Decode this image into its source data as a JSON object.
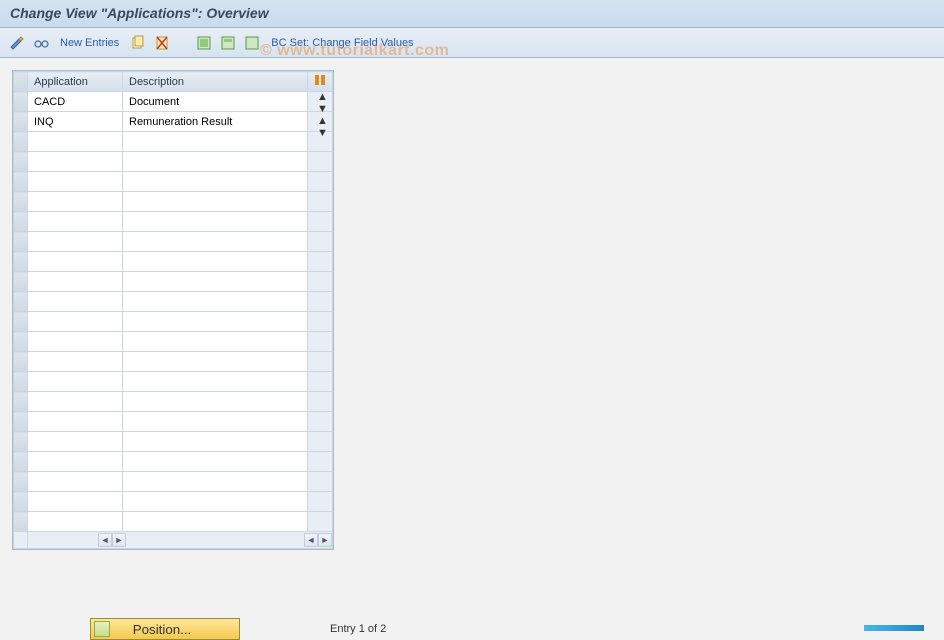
{
  "title": "Change View \"Applications\": Overview",
  "toolbar": {
    "new_entries": "New Entries",
    "bcset": "BC Set: Change Field Values"
  },
  "watermark": "© www.tutorialkart.com",
  "table": {
    "headers": {
      "application": "Application",
      "description": "Description"
    },
    "rows": [
      {
        "app": "CACD",
        "desc": "Document"
      },
      {
        "app": "INQ",
        "desc": "Remuneration Result"
      }
    ],
    "empty_row_count": 20
  },
  "footer": {
    "position_label": "Position...",
    "entry_text": "Entry 1 of 2"
  }
}
